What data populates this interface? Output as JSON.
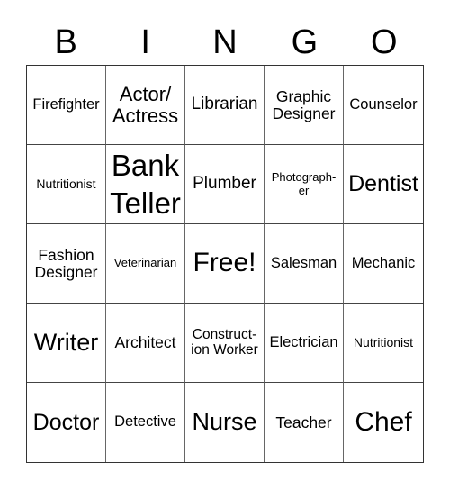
{
  "header": {
    "letters": [
      "B",
      "I",
      "N",
      "G",
      "O"
    ]
  },
  "cells": [
    [
      "Firefighter",
      "Actor/ Actress",
      "Librarian",
      "Graphic Designer",
      "Counselor"
    ],
    [
      "Nutritionist",
      "Bank Teller",
      "Plumber",
      "Photograph- er",
      "Dentist"
    ],
    [
      "Fashion Designer",
      "Veterinarian",
      "Free!",
      "Salesman",
      "Mechanic"
    ],
    [
      "Writer",
      "Architect",
      "Construct- ion Worker",
      "Electrician",
      "Nutritionist"
    ],
    [
      "Doctor",
      "Detective",
      "Nurse",
      "Teacher",
      "Chef"
    ]
  ]
}
